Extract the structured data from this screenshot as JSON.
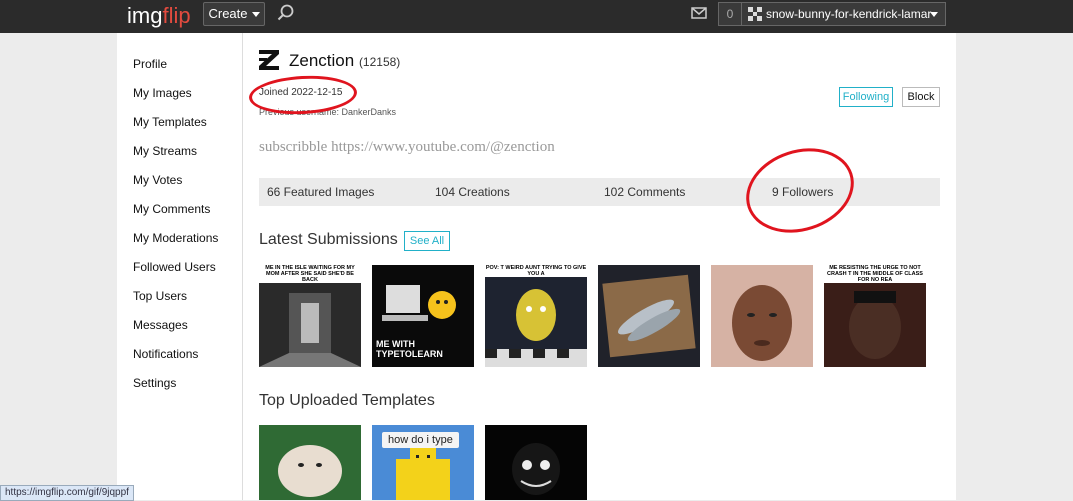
{
  "topbar": {
    "logo_img": "img",
    "logo_flip": "flip",
    "create_label": "Create",
    "notif_count": "0",
    "username": "snow-bunny-for-kendrick-lamar"
  },
  "sidebar": {
    "items": [
      {
        "label": "Profile"
      },
      {
        "label": "My Images"
      },
      {
        "label": "My Templates"
      },
      {
        "label": "My Streams"
      },
      {
        "label": "My Votes"
      },
      {
        "label": "My Comments"
      },
      {
        "label": "My Moderations"
      },
      {
        "label": "Followed Users"
      },
      {
        "label": "Top Users"
      },
      {
        "label": "Messages"
      },
      {
        "label": "Notifications"
      },
      {
        "label": "Settings"
      }
    ]
  },
  "profile": {
    "name": "Zenction",
    "points": "(12158)",
    "joined": "Joined 2022-12-15",
    "previous": "Previous username: DankerDanks",
    "bio": "subscribble https://www.youtube.com/@zenction",
    "following_label": "Following",
    "block_label": "Block"
  },
  "stats": [
    {
      "label": "66 Featured Images"
    },
    {
      "label": "104 Creations"
    },
    {
      "label": "102 Comments"
    },
    {
      "label": "9 Followers"
    }
  ],
  "latest": {
    "title": "Latest Submissions",
    "see_all": "See All",
    "thumbs": [
      {
        "caption": "ME IN THE ISLE WAITING FOR MY MOM AFTER SHE SAID SHE'D BE BACK",
        "bottom": ""
      },
      {
        "caption": "",
        "bottom": "ME WITH TYPETOLEARN"
      },
      {
        "caption": "POV: T WEIRD AUNT TRYING TO GIVE YOU A",
        "bottom": ""
      },
      {
        "caption": "",
        "bottom": ""
      },
      {
        "caption": "",
        "bottom": ""
      },
      {
        "caption": "ME RESISTING THE URGE TO NOT CRASH T IN THE MIDDLE OF CLASS FOR NO REA",
        "bottom": ""
      }
    ]
  },
  "templates": {
    "title": "Top Uploaded Templates",
    "thumbs": [
      {
        "caption": ""
      },
      {
        "caption": "how do i type"
      },
      {
        "caption": ""
      }
    ]
  },
  "status_link": "https://imgflip.com/gif/9jqppf"
}
